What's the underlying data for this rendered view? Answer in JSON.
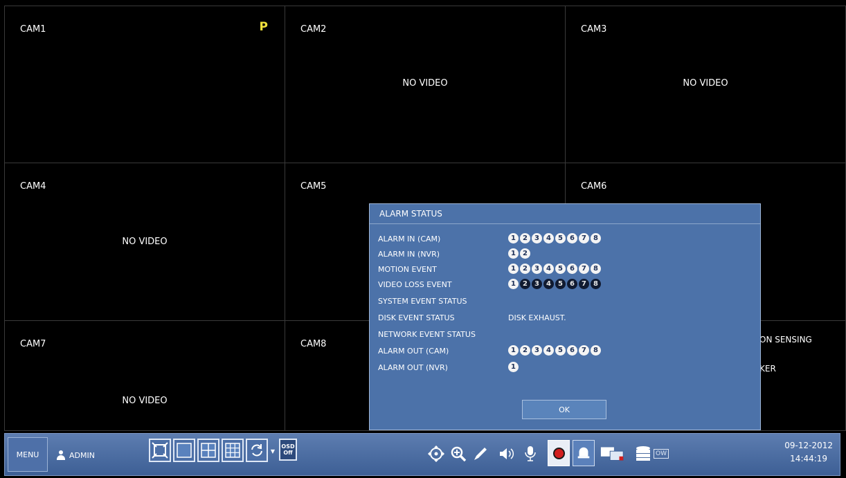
{
  "cameras": [
    {
      "label": "CAM1",
      "status": "P"
    },
    {
      "label": "CAM2",
      "status": "NO VIDEO"
    },
    {
      "label": "CAM3",
      "status": "NO VIDEO"
    },
    {
      "label": "CAM4",
      "status": "NO VIDEO"
    },
    {
      "label": "CAM5",
      "status": ""
    },
    {
      "label": "CAM6",
      "status": ""
    },
    {
      "label": "CAM7",
      "status": "NO VIDEO"
    },
    {
      "label": "CAM8",
      "status": ""
    }
  ],
  "cam9_partial": {
    "line1": "ON SENSING",
    "line2": "KER"
  },
  "alarm_dialog": {
    "title": "ALARM STATUS",
    "rows": [
      {
        "label": "ALARM IN (CAM)",
        "dots": [
          1,
          2,
          3,
          4,
          5,
          6,
          7,
          8
        ],
        "active": [
          1,
          2,
          3,
          4,
          5,
          6,
          7,
          8
        ]
      },
      {
        "label": "ALARM IN (NVR)",
        "dots": [
          1,
          2
        ],
        "active": [
          1,
          2
        ]
      },
      {
        "label": "MOTION EVENT",
        "dots": [
          1,
          2,
          3,
          4,
          5,
          6,
          7,
          8
        ],
        "active": [
          1,
          2,
          3,
          4,
          5,
          6,
          7,
          8
        ]
      },
      {
        "label": "VIDEO LOSS EVENT",
        "dots": [
          1,
          2,
          3,
          4,
          5,
          6,
          7,
          8
        ],
        "active": [
          1
        ]
      },
      {
        "label": "SYSTEM EVENT STATUS",
        "value": ""
      },
      {
        "label": "DISK EVENT STATUS",
        "value": "DISK EXHAUST."
      },
      {
        "label": "NETWORK EVENT STATUS",
        "value": ""
      },
      {
        "label": "ALARM OUT (CAM)",
        "dots": [
          1,
          2,
          3,
          4,
          5,
          6,
          7,
          8
        ],
        "active": [
          1,
          2,
          3,
          4,
          5,
          6,
          7,
          8
        ]
      },
      {
        "label": "ALARM OUT (NVR)",
        "dots": [
          1
        ],
        "active": [
          1
        ]
      }
    ],
    "ok_label": "OK"
  },
  "taskbar": {
    "menu_label": "MENU",
    "user_label": "ADMIN",
    "osd_line1": "OSD",
    "osd_line2": "Off",
    "ow_label": "OW",
    "date": "09-12-2012",
    "time": "14:44:19",
    "icons": [
      "fullscreen-icon",
      "single-layout-icon",
      "quad-layout-icon",
      "nine-layout-icon",
      "sequence-icon",
      "osd-icon",
      "ptz-icon",
      "zoom-icon",
      "freeze-icon",
      "audio-icon",
      "microphone-icon",
      "record-icon",
      "alarm-icon",
      "network-icon",
      "storage-icon"
    ]
  },
  "colors": {
    "panel_blue": "#4c72a9",
    "ptz_marker": "#f2e23c",
    "record_red": "#d21f1f"
  }
}
